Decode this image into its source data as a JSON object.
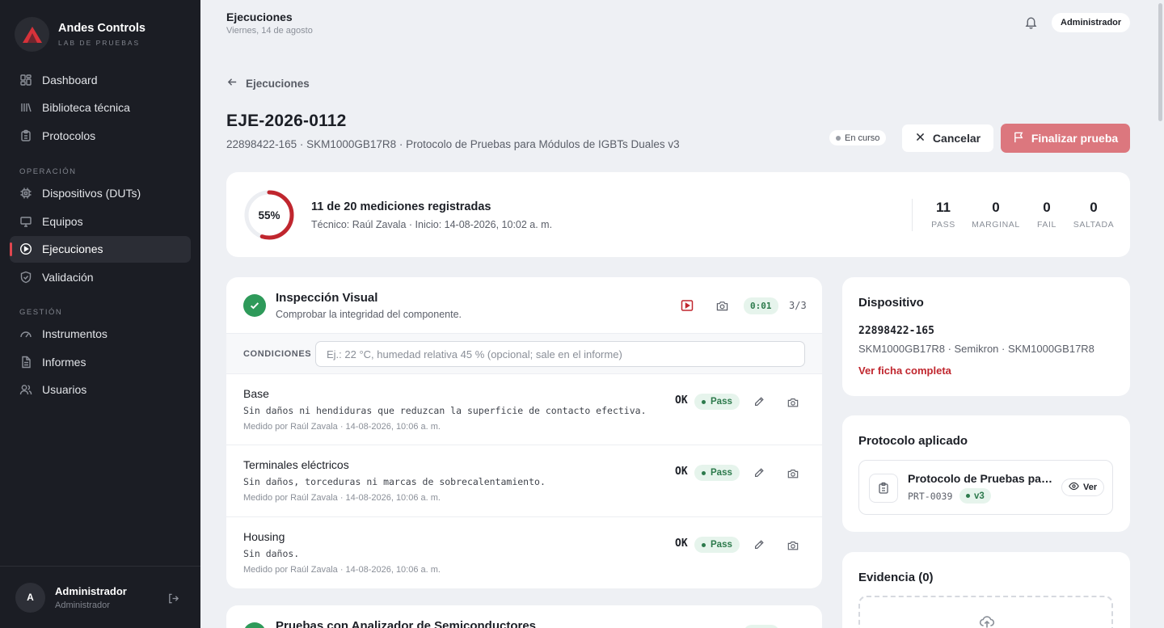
{
  "brand": {
    "name": "Andes Controls",
    "subtitle": "LAB DE PRUEBAS"
  },
  "sidebar": {
    "items_top": [
      {
        "label": "Dashboard",
        "icon": "dashboard-icon"
      },
      {
        "label": "Biblioteca técnica",
        "icon": "library-icon"
      },
      {
        "label": "Protocolos",
        "icon": "clipboard-icon"
      }
    ],
    "section_operation": "OPERACIÓN",
    "items_operation": [
      {
        "label": "Dispositivos (DUTs)",
        "icon": "chip-icon"
      },
      {
        "label": "Equipos",
        "icon": "monitor-icon"
      },
      {
        "label": "Ejecuciones",
        "icon": "play-circle-icon",
        "active": true
      },
      {
        "label": "Validación",
        "icon": "shield-check-icon"
      }
    ],
    "section_management": "GESTIÓN",
    "items_management": [
      {
        "label": "Instrumentos",
        "icon": "gauge-icon"
      },
      {
        "label": "Informes",
        "icon": "file-icon"
      },
      {
        "label": "Usuarios",
        "icon": "users-icon"
      }
    ],
    "user": {
      "initial": "A",
      "name": "Administrador",
      "role": "Administrador"
    }
  },
  "header": {
    "title": "Ejecuciones",
    "date": "Viernes, 14 de agosto",
    "user_pill": "Administrador"
  },
  "page": {
    "back_label": "Ejecuciones",
    "title": "EJE-2026-0112",
    "subtitle": "22898422-165 · SKM1000GB17R8 · Protocolo de Pruebas para Módulos de IGBTs Duales v3",
    "status": "En curso",
    "cancel_label": "Cancelar",
    "finish_label": "Finalizar prueba",
    "colors": {
      "accent": "#c0262e",
      "finish_button": "#dc777e",
      "pass": "#2e9a5a"
    }
  },
  "progress": {
    "percent_label": "55%",
    "fraction": 0.55,
    "title": "11 de 20 mediciones registradas",
    "meta": "Técnico: Raúl Zavala · Inicio: 14-08-2026, 10:02 a. m.",
    "stats": [
      {
        "value": "11",
        "label": "PASS"
      },
      {
        "value": "0",
        "label": "MARGINAL"
      },
      {
        "value": "0",
        "label": "FAIL"
      },
      {
        "value": "0",
        "label": "SALTADA"
      }
    ]
  },
  "step": {
    "title": "Inspección Visual",
    "description": "Comprobar la integridad del componente.",
    "timer": "0:01",
    "count": "3/3",
    "conditions_label": "CONDICIONES",
    "conditions_placeholder": "Ej.: 22 °C, humedad relativa 45 % (opcional; sale en el informe)",
    "measurements": [
      {
        "name": "Base",
        "spec": "Sin daños ni hendiduras que reduzcan la superficie de contacto efectiva.",
        "by": "Medido por Raúl Zavala · 14-08-2026, 10:06 a. m.",
        "value": "OK",
        "result": "Pass"
      },
      {
        "name": "Terminales eléctricos",
        "spec": "Sin daños, torceduras ni marcas de sobrecalentamiento.",
        "by": "Medido por Raúl Zavala · 14-08-2026, 10:06 a. m.",
        "value": "OK",
        "result": "Pass"
      },
      {
        "name": "Housing",
        "spec": "Sin daños.",
        "by": "Medido por Raúl Zavala · 14-08-2026, 10:06 a. m.",
        "value": "OK",
        "result": "Pass"
      }
    ]
  },
  "step2": {
    "title": "Pruebas con Analizador de Semiconductores"
  },
  "device": {
    "title": "Dispositivo",
    "id": "22898422-165",
    "sub": "SKM1000GB17R8 · Semikron · SKM1000GB17R8",
    "link": "Ver ficha completa"
  },
  "protocol": {
    "title": "Protocolo aplicado",
    "name": "Protocolo de Pruebas para Módulos de IGBTs Duales",
    "code": "PRT-0039",
    "version": "v3",
    "view_label": "Ver"
  },
  "evidence": {
    "title": "Evidencia (0)"
  }
}
